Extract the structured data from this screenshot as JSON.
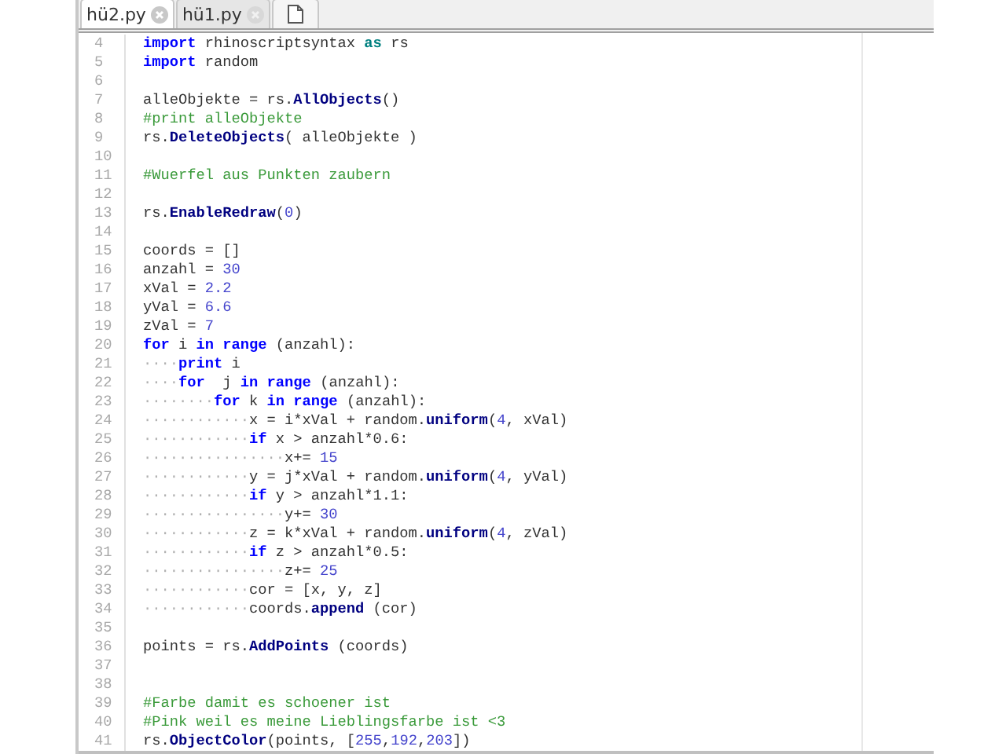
{
  "tabs": [
    {
      "label": "hü2.py",
      "selected": true
    },
    {
      "label": "hü1.py",
      "selected": false
    }
  ],
  "lines": [
    {
      "number": "4",
      "tokens": [
        {
          "kind": "kw",
          "text": "import"
        },
        {
          "kind": "tx",
          "text": " rhinoscriptsyntax "
        },
        {
          "kind": "as",
          "text": "as"
        },
        {
          "kind": "tx",
          "text": " rs"
        }
      ]
    },
    {
      "number": "5",
      "tokens": [
        {
          "kind": "kw",
          "text": "import"
        },
        {
          "kind": "tx",
          "text": " random"
        }
      ]
    },
    {
      "number": "6"
    },
    {
      "number": "7",
      "tokens": [
        {
          "kind": "tx",
          "text": "alleObjekte = rs."
        },
        {
          "kind": "fn",
          "text": "AllObjects"
        },
        {
          "kind": "tx",
          "text": "()"
        }
      ]
    },
    {
      "number": "8",
      "tokens": [
        {
          "kind": "cm",
          "text": "#print alleObjekte"
        }
      ]
    },
    {
      "number": "9",
      "tokens": [
        {
          "kind": "tx",
          "text": "rs."
        },
        {
          "kind": "fn",
          "text": "DeleteObjects"
        },
        {
          "kind": "tx",
          "text": "( alleObjekte )"
        }
      ]
    },
    {
      "number": "10"
    },
    {
      "number": "11",
      "tokens": [
        {
          "kind": "cm",
          "text": "#Wuerfel aus Punkten zaubern"
        }
      ]
    },
    {
      "number": "12"
    },
    {
      "number": "13",
      "tokens": [
        {
          "kind": "tx",
          "text": "rs."
        },
        {
          "kind": "fn",
          "text": "EnableRedraw"
        },
        {
          "kind": "tx",
          "text": "("
        },
        {
          "kind": "num",
          "text": "0"
        },
        {
          "kind": "tx",
          "text": ")"
        }
      ]
    },
    {
      "number": "14"
    },
    {
      "number": "15",
      "tokens": [
        {
          "kind": "tx",
          "text": "coords = []"
        }
      ]
    },
    {
      "number": "16",
      "tokens": [
        {
          "kind": "tx",
          "text": "anzahl = "
        },
        {
          "kind": "num",
          "text": "30"
        }
      ]
    },
    {
      "number": "17",
      "tokens": [
        {
          "kind": "tx",
          "text": "xVal = "
        },
        {
          "kind": "num",
          "text": "2.2"
        }
      ]
    },
    {
      "number": "18",
      "tokens": [
        {
          "kind": "tx",
          "text": "yVal = "
        },
        {
          "kind": "num",
          "text": "6.6"
        }
      ]
    },
    {
      "number": "19",
      "tokens": [
        {
          "kind": "tx",
          "text": "zVal = "
        },
        {
          "kind": "num",
          "text": "7"
        }
      ]
    },
    {
      "number": "20",
      "tokens": [
        {
          "kind": "kw",
          "text": "for"
        },
        {
          "kind": "tx",
          "text": " i "
        },
        {
          "kind": "kw",
          "text": "in range"
        },
        {
          "kind": "tx",
          "text": " (anzahl):"
        }
      ]
    },
    {
      "number": "21",
      "tokens": [
        {
          "kind": "ws",
          "text": "····"
        },
        {
          "kind": "kw",
          "text": "print"
        },
        {
          "kind": "tx",
          "text": " i"
        }
      ]
    },
    {
      "number": "22",
      "tokens": [
        {
          "kind": "ws",
          "text": "····"
        },
        {
          "kind": "kw",
          "text": "for"
        },
        {
          "kind": "tx",
          "text": "  j "
        },
        {
          "kind": "kw",
          "text": "in range"
        },
        {
          "kind": "tx",
          "text": " (anzahl):"
        }
      ]
    },
    {
      "number": "23",
      "tokens": [
        {
          "kind": "ws",
          "text": "········"
        },
        {
          "kind": "kw",
          "text": "for"
        },
        {
          "kind": "tx",
          "text": " k "
        },
        {
          "kind": "kw",
          "text": "in range"
        },
        {
          "kind": "tx",
          "text": " (anzahl):"
        }
      ]
    },
    {
      "number": "24",
      "tokens": [
        {
          "kind": "ws",
          "text": "············"
        },
        {
          "kind": "tx",
          "text": "x = i*xVal + random."
        },
        {
          "kind": "fn",
          "text": "uniform"
        },
        {
          "kind": "tx",
          "text": "("
        },
        {
          "kind": "num",
          "text": "4"
        },
        {
          "kind": "tx",
          "text": ", xVal)"
        }
      ]
    },
    {
      "number": "25",
      "tokens": [
        {
          "kind": "ws",
          "text": "············"
        },
        {
          "kind": "kw",
          "text": "if"
        },
        {
          "kind": "tx",
          "text": " x > anzahl*0.6:"
        }
      ]
    },
    {
      "number": "26",
      "tokens": [
        {
          "kind": "ws",
          "text": "················"
        },
        {
          "kind": "tx",
          "text": "x+= "
        },
        {
          "kind": "num",
          "text": "15"
        }
      ]
    },
    {
      "number": "27",
      "tokens": [
        {
          "kind": "ws",
          "text": "············"
        },
        {
          "kind": "tx",
          "text": "y = j*xVal + random."
        },
        {
          "kind": "fn",
          "text": "uniform"
        },
        {
          "kind": "tx",
          "text": "("
        },
        {
          "kind": "num",
          "text": "4"
        },
        {
          "kind": "tx",
          "text": ", yVal)"
        }
      ]
    },
    {
      "number": "28",
      "tokens": [
        {
          "kind": "ws",
          "text": "············"
        },
        {
          "kind": "kw",
          "text": "if"
        },
        {
          "kind": "tx",
          "text": " y > anzahl*1.1:"
        }
      ]
    },
    {
      "number": "29",
      "tokens": [
        {
          "kind": "ws",
          "text": "················"
        },
        {
          "kind": "tx",
          "text": "y+= "
        },
        {
          "kind": "num",
          "text": "30"
        }
      ]
    },
    {
      "number": "30",
      "tokens": [
        {
          "kind": "ws",
          "text": "············"
        },
        {
          "kind": "tx",
          "text": "z = k*xVal + random."
        },
        {
          "kind": "fn",
          "text": "uniform"
        },
        {
          "kind": "tx",
          "text": "("
        },
        {
          "kind": "num",
          "text": "4"
        },
        {
          "kind": "tx",
          "text": ", zVal)"
        }
      ]
    },
    {
      "number": "31",
      "tokens": [
        {
          "kind": "ws",
          "text": "············"
        },
        {
          "kind": "kw",
          "text": "if"
        },
        {
          "kind": "tx",
          "text": " z > anzahl*0.5:"
        }
      ]
    },
    {
      "number": "32",
      "tokens": [
        {
          "kind": "ws",
          "text": "················"
        },
        {
          "kind": "tx",
          "text": "z+= "
        },
        {
          "kind": "num",
          "text": "25"
        }
      ]
    },
    {
      "number": "33",
      "tokens": [
        {
          "kind": "ws",
          "text": "············"
        },
        {
          "kind": "tx",
          "text": "cor = [x, y, z]"
        }
      ]
    },
    {
      "number": "34",
      "tokens": [
        {
          "kind": "ws",
          "text": "············"
        },
        {
          "kind": "tx",
          "text": "coords."
        },
        {
          "kind": "fn",
          "text": "append"
        },
        {
          "kind": "tx",
          "text": " (cor)"
        }
      ]
    },
    {
      "number": "35"
    },
    {
      "number": "36",
      "tokens": [
        {
          "kind": "tx",
          "text": "points = rs."
        },
        {
          "kind": "fn",
          "text": "AddPoints"
        },
        {
          "kind": "tx",
          "text": " (coords)"
        }
      ]
    },
    {
      "number": "37"
    },
    {
      "number": "38"
    },
    {
      "number": "39",
      "tokens": [
        {
          "kind": "cm",
          "text": "#Farbe damit es schoener ist"
        }
      ]
    },
    {
      "number": "40",
      "tokens": [
        {
          "kind": "cm",
          "text": "#Pink weil es meine Lieblingsfarbe ist <3"
        }
      ]
    },
    {
      "number": "41",
      "tokens": [
        {
          "kind": "tx",
          "text": "rs."
        },
        {
          "kind": "fn",
          "text": "ObjectColor"
        },
        {
          "kind": "tx",
          "text": "(points, ["
        },
        {
          "kind": "num",
          "text": "255"
        },
        {
          "kind": "tx",
          "text": ","
        },
        {
          "kind": "num",
          "text": "192"
        },
        {
          "kind": "tx",
          "text": ","
        },
        {
          "kind": "num",
          "text": "203"
        },
        {
          "kind": "tx",
          "text": "])"
        }
      ]
    }
  ]
}
